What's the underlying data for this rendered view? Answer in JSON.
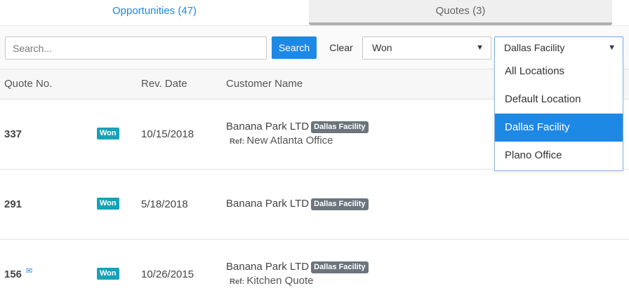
{
  "tabs": {
    "opportunities": "Opportunities (47)",
    "quotes": "Quotes (3)"
  },
  "filters": {
    "search_placeholder": "Search...",
    "search_value": "",
    "search_label": "Search",
    "clear_label": "Clear",
    "status_selected": "Won",
    "location_selected": "Dallas Facility"
  },
  "columns": {
    "quote_no": "Quote No.",
    "rev_date": "Rev. Date",
    "customer_name": "Customer Name"
  },
  "rows": [
    {
      "quote_no": "337",
      "status": "Won",
      "rev_date": "10/15/2018",
      "customer": "Banana Park LTD",
      "location": "Dallas Facility",
      "ref_label": "Ref:",
      "ref": "New Atlanta Office"
    },
    {
      "quote_no": "291",
      "status": "Won",
      "rev_date": "5/18/2018",
      "customer": "Banana Park LTD",
      "location": "Dallas Facility"
    },
    {
      "quote_no": "156",
      "status": "Won",
      "rev_date": "10/26/2015",
      "customer": "Banana Park LTD",
      "location": "Dallas Facility",
      "ref_label": "Ref:",
      "ref": "Kitchen Quote",
      "mail_icon": "envelope-icon"
    }
  ],
  "location_options": [
    "All Locations",
    "Default Location",
    "Dallas Facility",
    "Plano Office"
  ],
  "icons": {
    "caret": "caret-down-icon",
    "mail": "envelope-icon"
  },
  "colors": {
    "primary": "#1e88e5",
    "won_badge": "#17a2b8",
    "location_badge": "#6c757d"
  }
}
